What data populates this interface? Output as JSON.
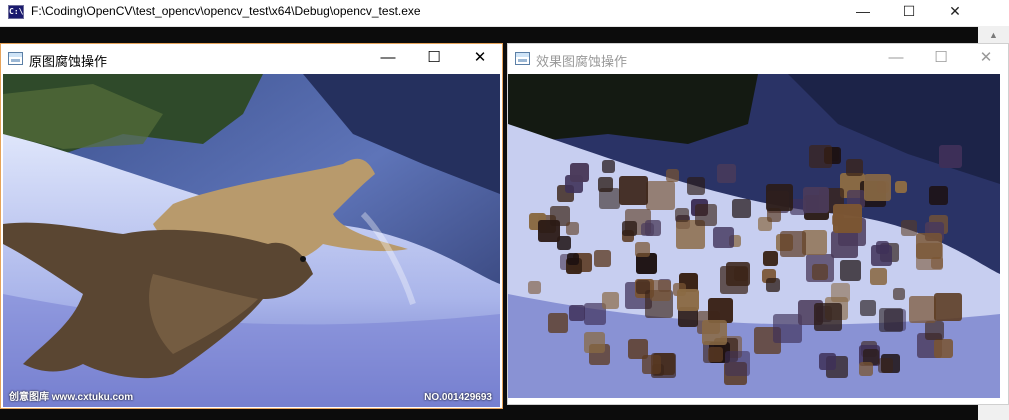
{
  "console": {
    "title": "F:\\Coding\\OpenCV\\test_opencv\\opencv_test\\x64\\Debug\\opencv_test.exe",
    "icon": "console-app-icon",
    "icon_text": "C:\\"
  },
  "controls": {
    "minimize": "—",
    "maximize": "☐",
    "close": "✕",
    "scroll_up": "▲"
  },
  "windows": [
    {
      "title": "原图腐蚀操作",
      "active": true,
      "watermark_left": "创意图库   www.cxtuku.com",
      "watermark_right": "NO.001429693"
    },
    {
      "title": "效果图腐蚀操作",
      "active": false
    }
  ],
  "colors": {
    "active_border": "#e6a35a",
    "inactive_text": "#999999",
    "console_bg": "#0c0c0c"
  }
}
